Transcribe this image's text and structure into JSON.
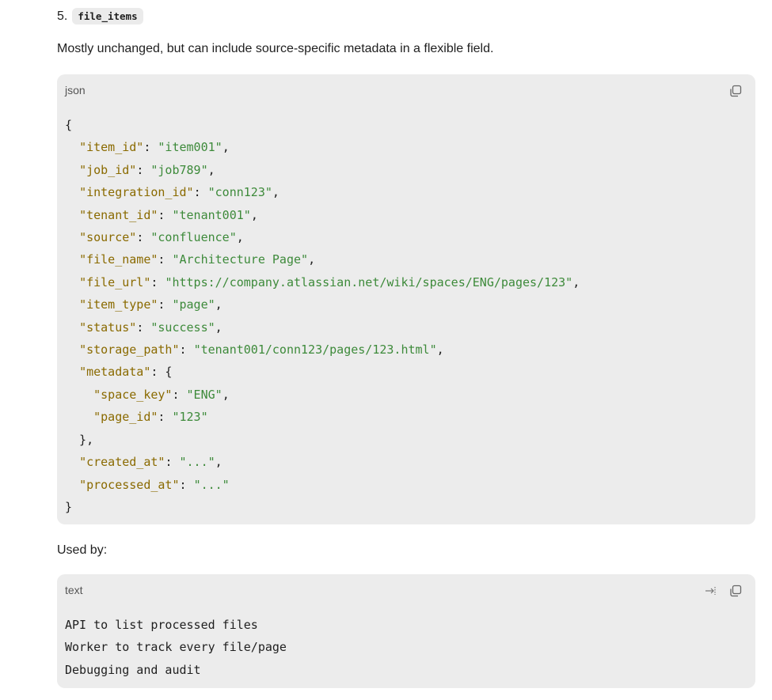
{
  "section": {
    "number": "5.",
    "code_title": "file_items",
    "description": "Mostly unchanged, but can include source-specific metadata in a flexible field."
  },
  "json_block": {
    "lang": "json",
    "lines": [
      [
        {
          "t": "p",
          "v": "{"
        }
      ],
      [
        {
          "t": "p",
          "v": "  "
        },
        {
          "t": "k",
          "v": "\"item_id\""
        },
        {
          "t": "p",
          "v": ": "
        },
        {
          "t": "s",
          "v": "\"item001\""
        },
        {
          "t": "p",
          "v": ","
        }
      ],
      [
        {
          "t": "p",
          "v": "  "
        },
        {
          "t": "k",
          "v": "\"job_id\""
        },
        {
          "t": "p",
          "v": ": "
        },
        {
          "t": "s",
          "v": "\"job789\""
        },
        {
          "t": "p",
          "v": ","
        }
      ],
      [
        {
          "t": "p",
          "v": "  "
        },
        {
          "t": "k",
          "v": "\"integration_id\""
        },
        {
          "t": "p",
          "v": ": "
        },
        {
          "t": "s",
          "v": "\"conn123\""
        },
        {
          "t": "p",
          "v": ","
        }
      ],
      [
        {
          "t": "p",
          "v": "  "
        },
        {
          "t": "k",
          "v": "\"tenant_id\""
        },
        {
          "t": "p",
          "v": ": "
        },
        {
          "t": "s",
          "v": "\"tenant001\""
        },
        {
          "t": "p",
          "v": ","
        }
      ],
      [
        {
          "t": "p",
          "v": "  "
        },
        {
          "t": "k",
          "v": "\"source\""
        },
        {
          "t": "p",
          "v": ": "
        },
        {
          "t": "s",
          "v": "\"confluence\""
        },
        {
          "t": "p",
          "v": ","
        }
      ],
      [
        {
          "t": "p",
          "v": "  "
        },
        {
          "t": "k",
          "v": "\"file_name\""
        },
        {
          "t": "p",
          "v": ": "
        },
        {
          "t": "s",
          "v": "\"Architecture Page\""
        },
        {
          "t": "p",
          "v": ","
        }
      ],
      [
        {
          "t": "p",
          "v": "  "
        },
        {
          "t": "k",
          "v": "\"file_url\""
        },
        {
          "t": "p",
          "v": ": "
        },
        {
          "t": "s",
          "v": "\"https://company.atlassian.net/wiki/spaces/ENG/pages/123\""
        },
        {
          "t": "p",
          "v": ","
        }
      ],
      [
        {
          "t": "p",
          "v": "  "
        },
        {
          "t": "k",
          "v": "\"item_type\""
        },
        {
          "t": "p",
          "v": ": "
        },
        {
          "t": "s",
          "v": "\"page\""
        },
        {
          "t": "p",
          "v": ","
        }
      ],
      [
        {
          "t": "p",
          "v": "  "
        },
        {
          "t": "k",
          "v": "\"status\""
        },
        {
          "t": "p",
          "v": ": "
        },
        {
          "t": "s",
          "v": "\"success\""
        },
        {
          "t": "p",
          "v": ","
        }
      ],
      [
        {
          "t": "p",
          "v": "  "
        },
        {
          "t": "k",
          "v": "\"storage_path\""
        },
        {
          "t": "p",
          "v": ": "
        },
        {
          "t": "s",
          "v": "\"tenant001/conn123/pages/123.html\""
        },
        {
          "t": "p",
          "v": ","
        }
      ],
      [
        {
          "t": "p",
          "v": "  "
        },
        {
          "t": "k",
          "v": "\"metadata\""
        },
        {
          "t": "p",
          "v": ": {"
        }
      ],
      [
        {
          "t": "p",
          "v": "    "
        },
        {
          "t": "k",
          "v": "\"space_key\""
        },
        {
          "t": "p",
          "v": ": "
        },
        {
          "t": "s",
          "v": "\"ENG\""
        },
        {
          "t": "p",
          "v": ","
        }
      ],
      [
        {
          "t": "p",
          "v": "    "
        },
        {
          "t": "k",
          "v": "\"page_id\""
        },
        {
          "t": "p",
          "v": ": "
        },
        {
          "t": "s",
          "v": "\"123\""
        }
      ],
      [
        {
          "t": "p",
          "v": "  },"
        }
      ],
      [
        {
          "t": "p",
          "v": "  "
        },
        {
          "t": "k",
          "v": "\"created_at\""
        },
        {
          "t": "p",
          "v": ": "
        },
        {
          "t": "s",
          "v": "\"...\""
        },
        {
          "t": "p",
          "v": ","
        }
      ],
      [
        {
          "t": "p",
          "v": "  "
        },
        {
          "t": "k",
          "v": "\"processed_at\""
        },
        {
          "t": "p",
          "v": ": "
        },
        {
          "t": "s",
          "v": "\"...\""
        }
      ],
      [
        {
          "t": "p",
          "v": "}"
        }
      ]
    ]
  },
  "used_by_label": "Used by:",
  "text_block": {
    "lang": "text",
    "lines": [
      "API to list processed files",
      "Worker to track every file/page",
      "Debugging and audit"
    ]
  },
  "colors": {
    "key": "#8a6a00",
    "string": "#3d8a3a",
    "code_bg": "#ececec"
  },
  "icons": [
    "copy-icon",
    "wrap-icon"
  ]
}
